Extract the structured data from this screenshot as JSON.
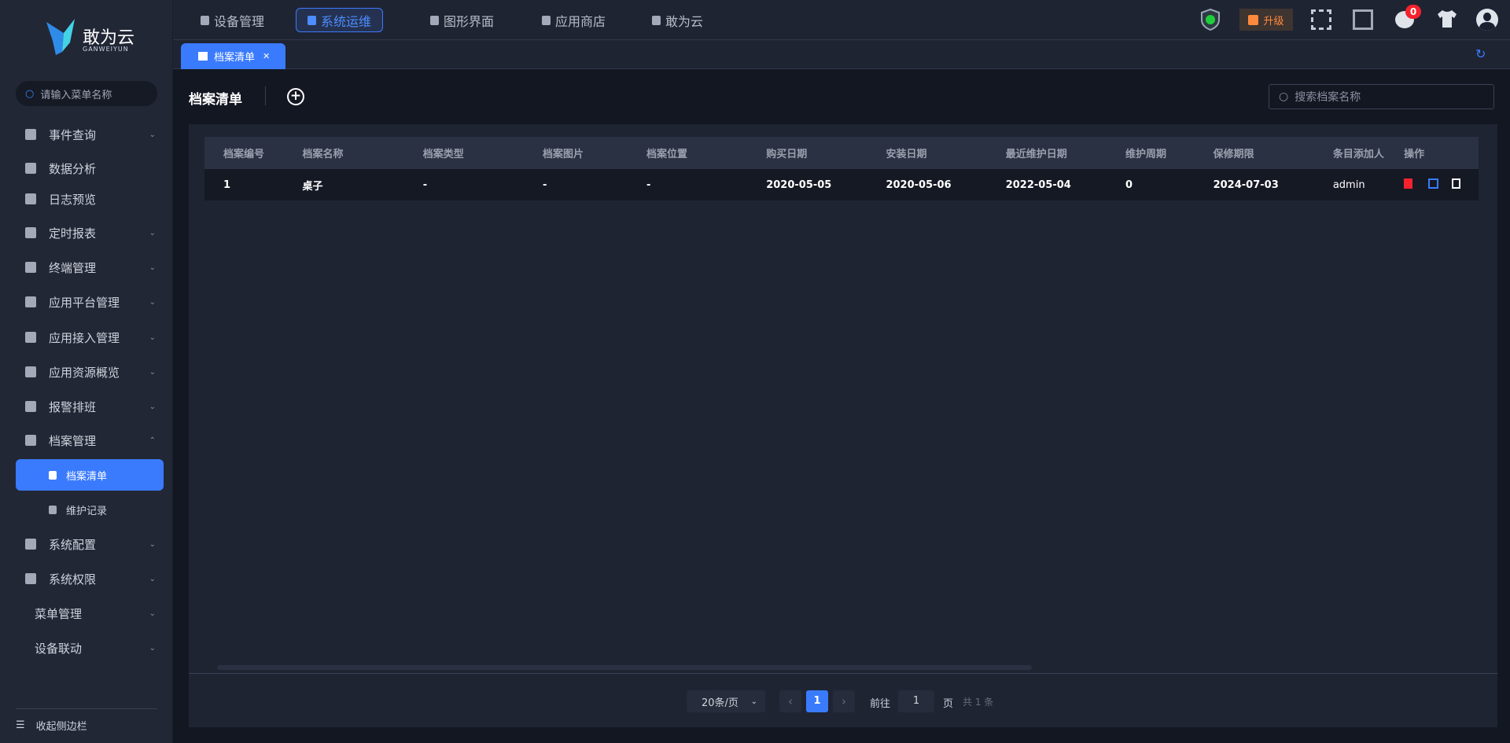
{
  "brand": {
    "name": "敢为云",
    "sub": "GANWEIYUN"
  },
  "sidebar": {
    "search_placeholder": "请输入菜单名称",
    "items": [
      {
        "label": "事件查询",
        "chev": "⌄"
      },
      {
        "label": "数据分析"
      },
      {
        "label": "日志预览"
      },
      {
        "label": "定时报表",
        "chev": "⌄"
      },
      {
        "label": "终端管理",
        "chev": "⌄"
      },
      {
        "label": "应用平台管理",
        "chev": "⌄"
      },
      {
        "label": "应用接入管理",
        "chev": "⌄"
      },
      {
        "label": "应用资源概览",
        "chev": "⌄"
      },
      {
        "label": "报警排班",
        "chev": "⌄"
      },
      {
        "label": "档案管理",
        "chev": "⌃"
      },
      {
        "label": "档案清单"
      },
      {
        "label": "维护记录"
      },
      {
        "label": "系统配置",
        "chev": "⌄"
      },
      {
        "label": "系统权限",
        "chev": "⌄"
      },
      {
        "label": "菜单管理",
        "chev": "⌄"
      },
      {
        "label": "设备联动",
        "chev": "⌄"
      }
    ],
    "collapse": "收起侧边栏"
  },
  "topnav": [
    "设备管理",
    "系统运维",
    "图形界面",
    "应用商店",
    "敢为云"
  ],
  "header": {
    "upgrade": "升级",
    "badge": "0"
  },
  "tabs": [
    {
      "label": "档案清单",
      "close": "✕"
    }
  ],
  "page": {
    "title": "档案清单",
    "search_placeholder": "搜索档案名称"
  },
  "table": {
    "columns": [
      "档案编号",
      "档案名称",
      "档案类型",
      "档案图片",
      "档案位置",
      "购买日期",
      "安装日期",
      "最近维护日期",
      "维护周期",
      "保修期限",
      "条目添加人",
      "操作"
    ],
    "rows": [
      [
        "1",
        "桌子",
        "-",
        "-",
        "-",
        "2020-05-05",
        "2020-05-06",
        "2022-05-04",
        "0",
        "2024-07-03",
        "admin"
      ]
    ]
  },
  "pagination": {
    "page_size": "20条/页",
    "current": "1",
    "goto_label": "前往",
    "goto_value": "1",
    "page_unit": "页",
    "total": "共 1 条"
  },
  "colors": {
    "accent": "#3a7bfd",
    "danger": "#f5222d",
    "upgrade": "#ff8a3d"
  }
}
